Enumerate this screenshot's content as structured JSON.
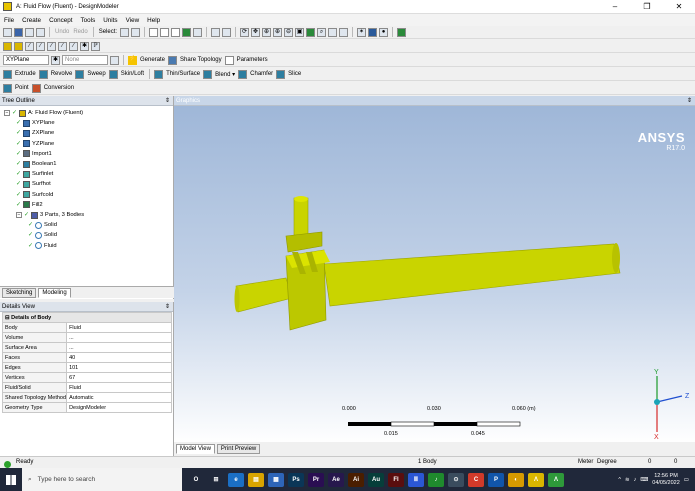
{
  "window": {
    "title": "A: Fluid Flow (Fluent) - DesignModeler",
    "controls": [
      "–",
      "❐",
      "✕"
    ]
  },
  "menu": [
    "File",
    "Create",
    "Concept",
    "Tools",
    "Units",
    "View",
    "Help"
  ],
  "toolbar1": {
    "undo": "Undo",
    "redo": "Redo",
    "select": "Select:"
  },
  "toolbar3": {
    "plane": "XYPlane",
    "sketch": "None",
    "generate": "Generate",
    "share_topology": "Share Topology",
    "parameters": "Parameters"
  },
  "toolbar4": {
    "extrude": "Extrude",
    "revolve": "Revolve",
    "sweep": "Sweep",
    "skin_loft": "Skin/Loft",
    "thin_surface": "Thin/Surface",
    "blend": "Blend ▾",
    "chamfer": "Chamfer",
    "slice": "Slice"
  },
  "toolbar5": {
    "point": "Point",
    "conversion": "Conversion"
  },
  "tree": {
    "header": "Tree Outline",
    "items": [
      {
        "label": "A: Fluid Flow (Fluent)",
        "icon": "root",
        "indent": 0
      },
      {
        "label": "XYPlane",
        "icon": "plane",
        "indent": 1
      },
      {
        "label": "ZXPlane",
        "icon": "plane",
        "indent": 1
      },
      {
        "label": "YZPlane",
        "icon": "plane",
        "indent": 1
      },
      {
        "label": "Import1",
        "icon": "import",
        "indent": 1
      },
      {
        "label": "Boolean1",
        "icon": "bool",
        "indent": 1
      },
      {
        "label": "Surfinlet",
        "icon": "surf",
        "indent": 1
      },
      {
        "label": "Surfhot",
        "icon": "surf",
        "indent": 1
      },
      {
        "label": "Surfcold",
        "icon": "surf",
        "indent": 1
      },
      {
        "label": "Fill2",
        "icon": "fill",
        "indent": 1
      },
      {
        "label": "3 Parts, 3 Bodies",
        "icon": "parts",
        "indent": 1
      },
      {
        "label": "Solid",
        "icon": "body",
        "indent": 2
      },
      {
        "label": "Solid",
        "icon": "body",
        "indent": 2
      },
      {
        "label": "Fluid",
        "icon": "body",
        "indent": 2
      }
    ]
  },
  "left_tabs": [
    "Sketching",
    "Modeling"
  ],
  "details": {
    "header": "Details View",
    "group": "Details of Body",
    "rows": [
      {
        "key": "Body",
        "value": "Fluid"
      },
      {
        "key": "Volume",
        "value": "..."
      },
      {
        "key": "Surface Area",
        "value": "..."
      },
      {
        "key": "Faces",
        "value": "40"
      },
      {
        "key": "Edges",
        "value": "101"
      },
      {
        "key": "Vertices",
        "value": "67"
      },
      {
        "key": "Fluid/Solid",
        "value": "Fluid"
      },
      {
        "key": "Shared Topology Method",
        "value": "Automatic"
      },
      {
        "key": "Geometry Type",
        "value": "DesignModeler"
      }
    ]
  },
  "graphics": {
    "header": "Graphics",
    "brand": "ANSYS",
    "version": "R17.0",
    "scale_top": [
      "0.000",
      "0.030",
      "0.060 (m)"
    ],
    "scale_bottom": [
      "0.015",
      "0.045"
    ],
    "axes": {
      "x": "X",
      "y": "Y",
      "z": "Z"
    },
    "model_color": "#c9d400",
    "tabs": [
      "Model View",
      "Print Preview"
    ]
  },
  "status": {
    "ready": "Ready",
    "selection": "1 Body",
    "units": "Meter",
    "angle": "Degree",
    "v1": "0",
    "v2": "0"
  },
  "taskbar": {
    "search_placeholder": "Type here to search",
    "time": "12:56 PM",
    "date": "04/05/2022",
    "apps": [
      {
        "label": "O",
        "color": "#20283a"
      },
      {
        "label": "⊞",
        "color": "#20283a"
      },
      {
        "label": "e",
        "color": "#1b6fc4"
      },
      {
        "label": "▤",
        "color": "#d9a400"
      },
      {
        "label": "▦",
        "color": "#2e65b8"
      },
      {
        "label": "Ps",
        "color": "#0a3657"
      },
      {
        "label": "Pr",
        "color": "#2a0e52"
      },
      {
        "label": "Ae",
        "color": "#27184d"
      },
      {
        "label": "Ai",
        "color": "#4a1e00"
      },
      {
        "label": "Au",
        "color": "#063e3a"
      },
      {
        "label": "Fl",
        "color": "#5a0e0e"
      },
      {
        "label": "Ⅲ",
        "color": "#2b57d4"
      },
      {
        "label": "♪",
        "color": "#1f8a2d"
      },
      {
        "label": "⊙",
        "color": "#3a4c5e"
      },
      {
        "label": "C",
        "color": "#d23a2a"
      },
      {
        "label": "P",
        "color": "#1155aa"
      },
      {
        "label": "◐",
        "color": "#d69a00"
      },
      {
        "label": "Λ",
        "color": "#d9b600"
      },
      {
        "label": "Λ",
        "color": "#2e9a3a"
      }
    ]
  }
}
